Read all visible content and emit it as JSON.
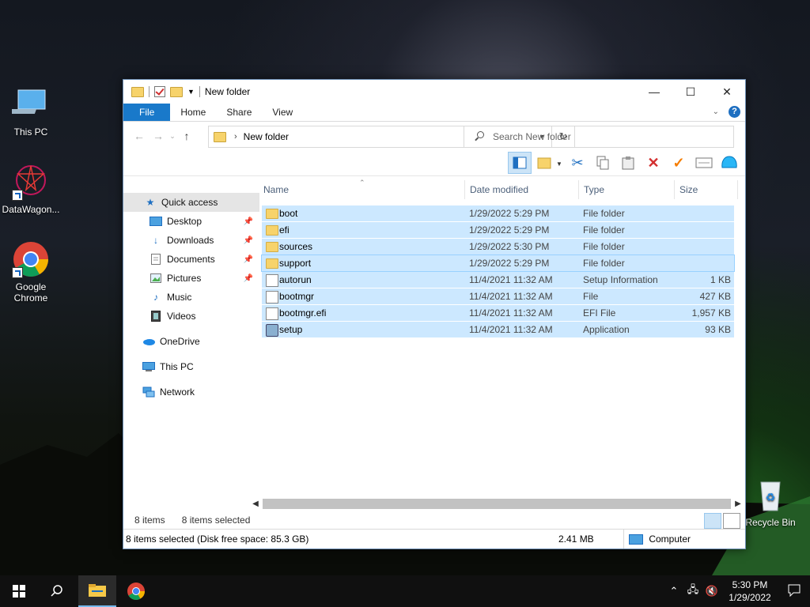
{
  "desktop": {
    "icons": [
      {
        "label": "This PC"
      },
      {
        "label": "DataWagon..."
      },
      {
        "label": "Google Chrome"
      },
      {
        "label": "Recycle Bin"
      }
    ]
  },
  "window": {
    "title": "New folder",
    "tabs": [
      "File",
      "Home",
      "Share",
      "View"
    ],
    "address": "New folder",
    "search_placeholder": "Search New folder"
  },
  "nav": [
    {
      "label": "Quick access",
      "icon": "star-icon"
    },
    {
      "label": "Desktop",
      "icon": "desktop-icon",
      "pinned": true
    },
    {
      "label": "Downloads",
      "icon": "download-icon",
      "pinned": true
    },
    {
      "label": "Documents",
      "icon": "document-icon",
      "pinned": true
    },
    {
      "label": "Pictures",
      "icon": "pictures-icon",
      "pinned": true
    },
    {
      "label": "Music",
      "icon": "music-icon"
    },
    {
      "label": "Videos",
      "icon": "video-icon"
    },
    {
      "label": "OneDrive",
      "icon": "cloud-icon"
    },
    {
      "label": "This PC",
      "icon": "computer-icon"
    },
    {
      "label": "Network",
      "icon": "network-icon"
    }
  ],
  "columns": [
    "Name",
    "Date modified",
    "Type",
    "Size"
  ],
  "files": [
    {
      "name": "boot",
      "date": "1/29/2022 5:29 PM",
      "type": "File folder",
      "size": "",
      "kind": "folder"
    },
    {
      "name": "efi",
      "date": "1/29/2022 5:29 PM",
      "type": "File folder",
      "size": "",
      "kind": "folder"
    },
    {
      "name": "sources",
      "date": "1/29/2022 5:30 PM",
      "type": "File folder",
      "size": "",
      "kind": "folder"
    },
    {
      "name": "support",
      "date": "1/29/2022 5:29 PM",
      "type": "File folder",
      "size": "",
      "kind": "folder"
    },
    {
      "name": "autorun",
      "date": "11/4/2021 11:32 AM",
      "type": "Setup Information",
      "size": "1 KB",
      "kind": "file"
    },
    {
      "name": "bootmgr",
      "date": "11/4/2021 11:32 AM",
      "type": "File",
      "size": "427 KB",
      "kind": "file"
    },
    {
      "name": "bootmgr.efi",
      "date": "11/4/2021 11:32 AM",
      "type": "EFI File",
      "size": "1,957 KB",
      "kind": "file"
    },
    {
      "name": "setup",
      "date": "11/4/2021 11:32 AM",
      "type": "Application",
      "size": "93 KB",
      "kind": "app"
    }
  ],
  "status": {
    "items": "8 items",
    "selected": "8 items selected"
  },
  "infobar": {
    "selection": "8 items selected (Disk free space: 85.3 GB)",
    "size": "2.41 MB",
    "location": "Computer"
  },
  "taskbar": {
    "time": "5:30 PM",
    "date": "1/29/2022"
  }
}
